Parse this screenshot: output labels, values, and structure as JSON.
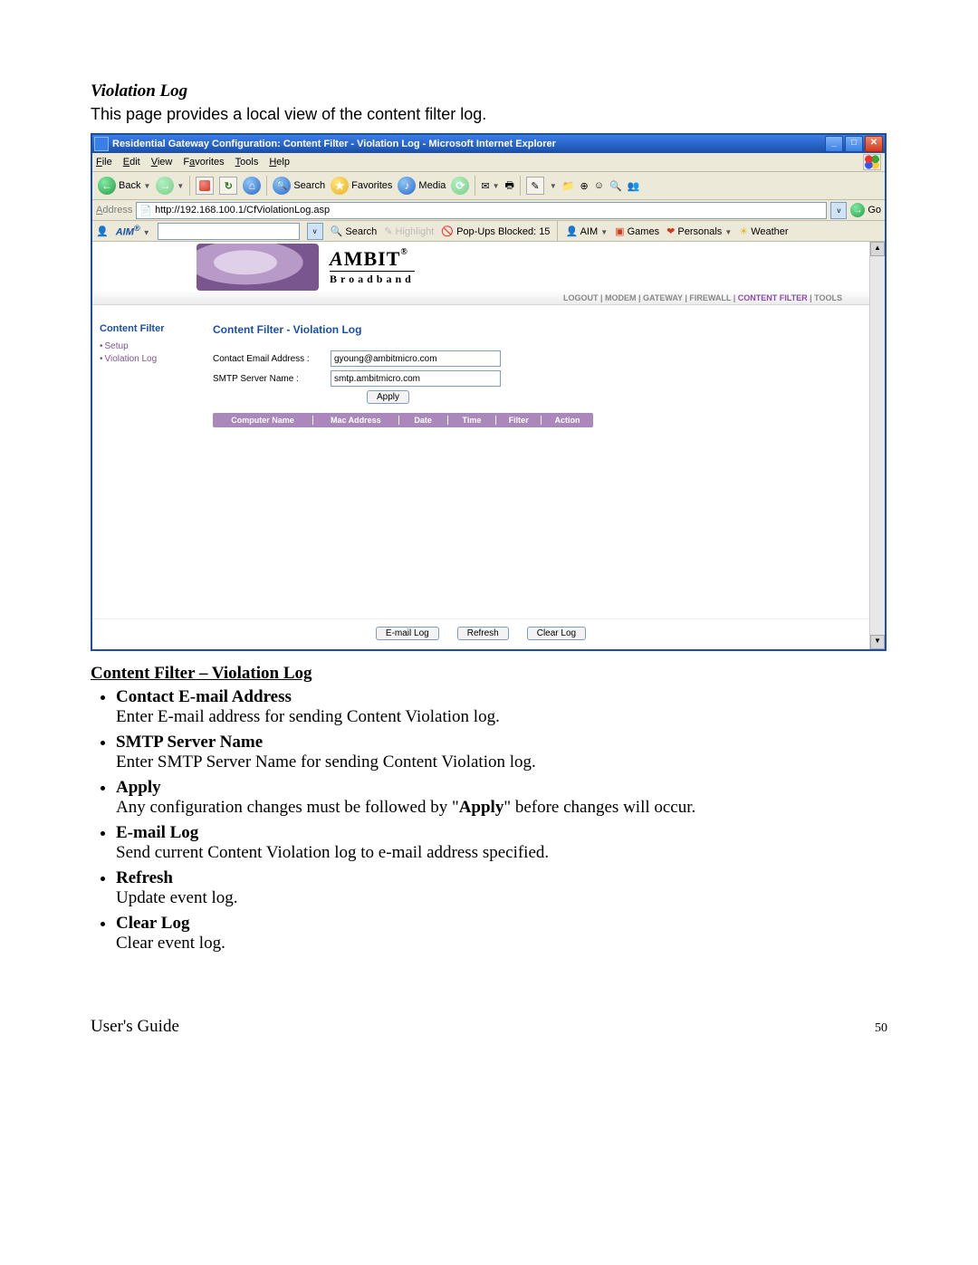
{
  "doc": {
    "section_title": "Violation Log",
    "section_intro": "This page provides a local view of the content filter log.",
    "cf_title": "Content Filter – Violation Log",
    "items": {
      "contact": {
        "term": "Contact E-mail Address",
        "desc": "Enter E-mail address for sending Content Violation log."
      },
      "smtp": {
        "term": "SMTP Server Name",
        "desc": "Enter SMTP Server Name for sending Content Violation log."
      },
      "apply": {
        "term": "Apply",
        "desc_pre": "Any configuration changes must be followed by \"",
        "desc_bold": "Apply",
        "desc_post": "\" before changes will occur."
      },
      "emaillog": {
        "term": "E-mail Log",
        "desc": "Send current Content Violation log to e-mail address specified."
      },
      "refresh": {
        "term": "Refresh",
        "desc": "Update event log."
      },
      "clear": {
        "term": "Clear Log",
        "desc": "Clear event log."
      }
    },
    "footer_left": "User's Guide",
    "footer_page": "50"
  },
  "window": {
    "title": "Residential Gateway Configuration: Content Filter - Violation Log - Microsoft Internet Explorer",
    "min": "_",
    "max": "□",
    "close": "✕"
  },
  "menubar": {
    "file": "File",
    "edit": "Edit",
    "view": "View",
    "favorites": "Favorites",
    "tools": "Tools",
    "help": "Help"
  },
  "toolbar": {
    "back": "Back",
    "search": "Search",
    "favorites": "Favorites",
    "media": "Media",
    "stop": "✕",
    "refresh": "↻",
    "home": "⌂"
  },
  "address": {
    "label": "Address",
    "url": "http://192.168.100.1/CfViolationLog.asp",
    "go": "Go"
  },
  "aimbar": {
    "logo": "AIM",
    "search": "Search",
    "highlight": "Highlight",
    "popups": "Pop-Ups Blocked: 15",
    "aim": "AIM",
    "games": "Games",
    "personals": "Personals",
    "weather": "Weather"
  },
  "brand": {
    "name_first": "A",
    "name_rest": "MBIT",
    "reg": "®",
    "bb": "Broadband"
  },
  "topnav": {
    "logout": "LOGOUT",
    "modem": "MODEM",
    "gateway": "GATEWAY",
    "firewall": "FIREWALL",
    "cf": "CONTENT FILTER",
    "tools": "TOOLS",
    "sep": " | "
  },
  "sidenav": {
    "hdr": "Content Filter",
    "setup": "Setup",
    "vlog": "Violation Log"
  },
  "panel": {
    "title": "Content Filter - Violation Log",
    "email_label": "Contact Email Address :",
    "email_value": "gyoung@ambitmicro.com",
    "smtp_label": "SMTP Server Name :",
    "smtp_value": "smtp.ambitmicro.com",
    "apply": "Apply",
    "cols": {
      "c1": "Computer Name",
      "c2": "Mac Address",
      "c3": "Date",
      "c4": "Time",
      "c5": "Filter",
      "c6": "Action"
    },
    "btn_email": "E-mail Log",
    "btn_refresh": "Refresh",
    "btn_clear": "Clear Log"
  }
}
